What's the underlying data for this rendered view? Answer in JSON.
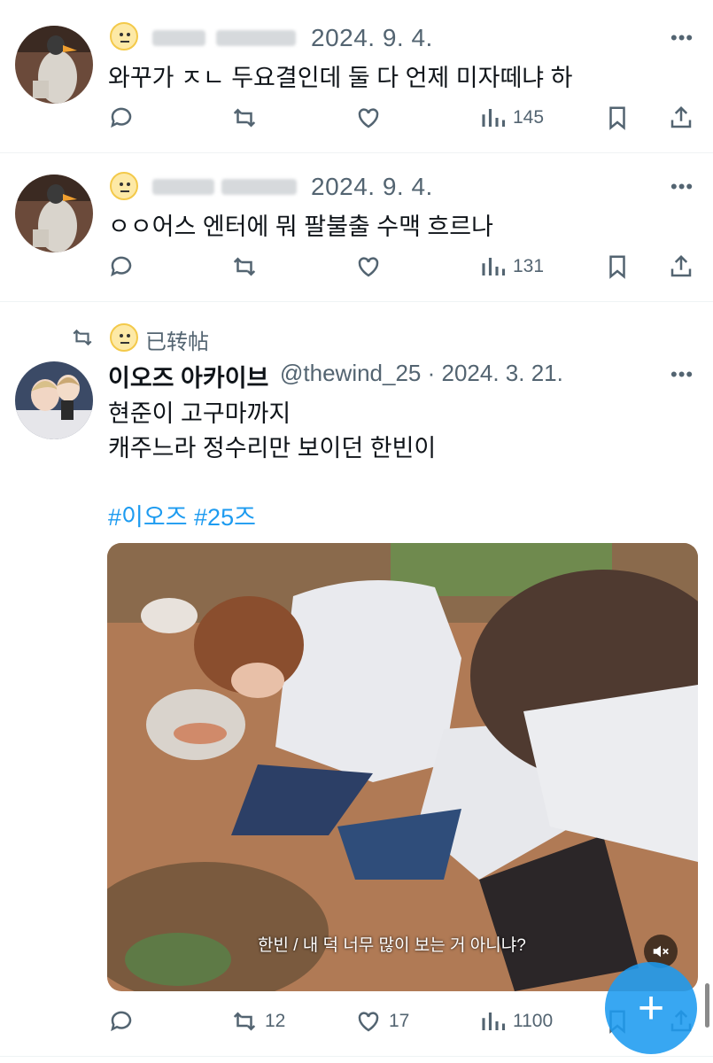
{
  "tweets": [
    {
      "date": "2024. 9. 4.",
      "text": "와꾸가 ㅈㄴ 두요결인데 둘 다 언제 미자떼냐 하",
      "views": "145"
    },
    {
      "date": "2024. 9. 4.",
      "text": "ㅇㅇ어스 엔터에 뭐 팔불출 수맥 흐르나",
      "views": "131"
    }
  ],
  "repost": {
    "label": "已转帖",
    "author_name": "이오즈 아카이브",
    "handle_date": "@thewind_25 · 2024. 3. 21.",
    "line1": "현준이 고구마까지",
    "line2": "캐주느라 정수리만 보이던 한빈이",
    "hashtags": "#이오즈 #25즈",
    "media_subtitle": "한빈 / 내 덕 너무 많이 보는 거 아니냐?",
    "replies": "",
    "retweets": "12",
    "likes": "17",
    "views": "1100"
  },
  "more_glyph": "•••",
  "fab_glyph": "+",
  "colors": {
    "accent": "#1d9bf0",
    "muted": "#536471"
  }
}
